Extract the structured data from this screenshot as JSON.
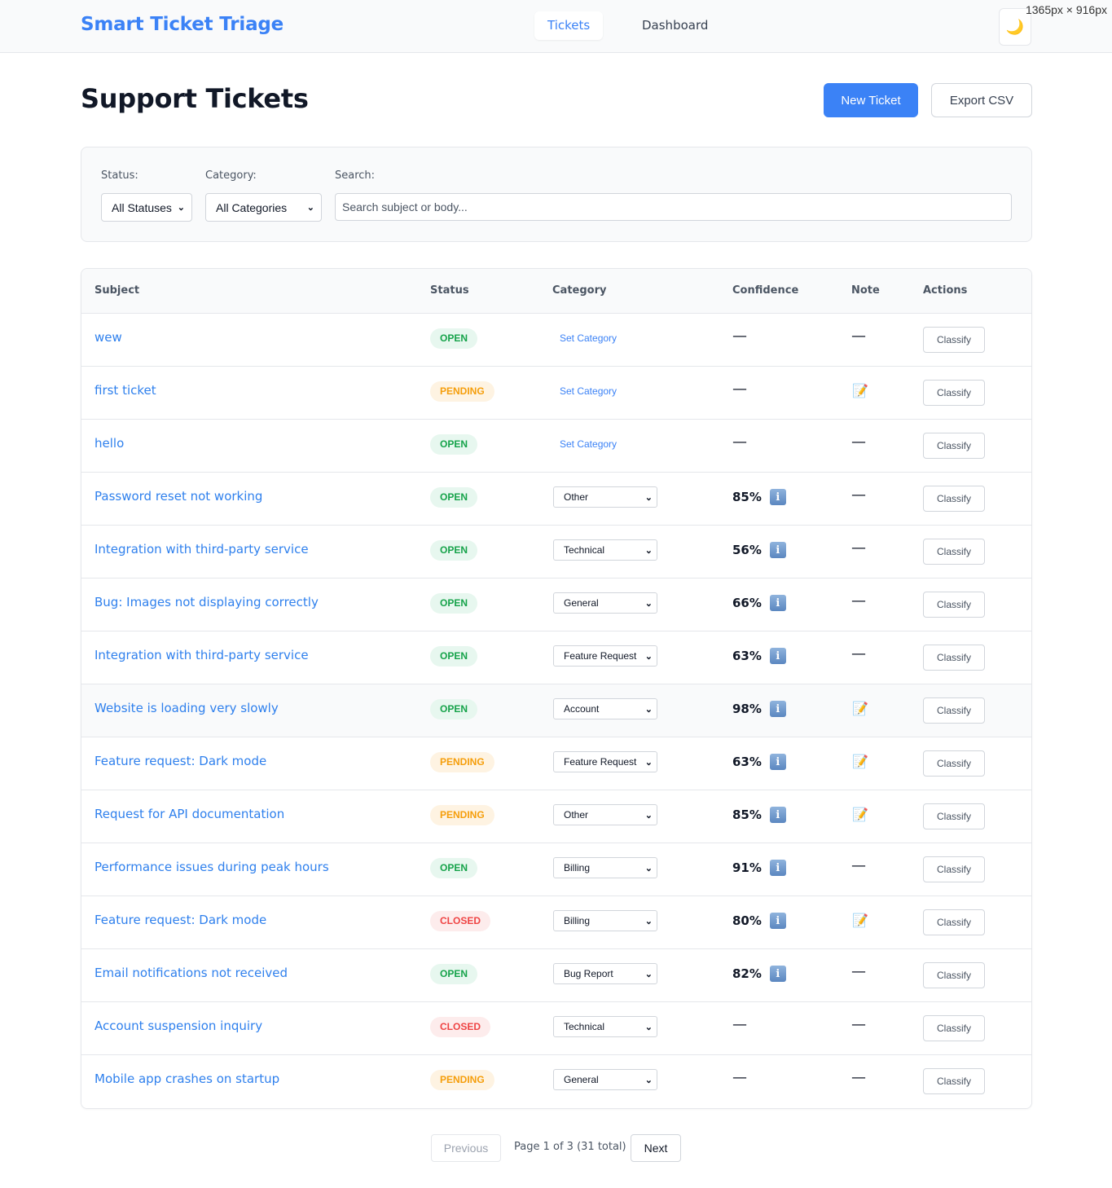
{
  "viewport_label": "1365px × 916px",
  "app": {
    "title": "Smart Ticket Triage"
  },
  "nav": {
    "tabs": [
      {
        "label": "Tickets",
        "active": true
      },
      {
        "label": "Dashboard",
        "active": false
      }
    ],
    "theme_icon": "🌙"
  },
  "page": {
    "title": "Support Tickets",
    "new_ticket": "New Ticket",
    "export_csv": "Export CSV"
  },
  "filters": {
    "status_label": "Status:",
    "status_value": "All Statuses",
    "category_label": "Category:",
    "category_value": "All Categories",
    "search_label": "Search:",
    "search_placeholder": "Search subject or body..."
  },
  "table": {
    "columns": [
      "Subject",
      "Status",
      "Category",
      "Confidence",
      "Note",
      "Actions"
    ],
    "dash": "—",
    "note_icon": "📝",
    "info_icon": "i",
    "set_category": "Set Category",
    "classify": "Classify",
    "rows": [
      {
        "subject": "wew",
        "status": "OPEN",
        "category": null,
        "confidence": null,
        "note": false
      },
      {
        "subject": "first ticket",
        "status": "PENDING",
        "category": null,
        "confidence": null,
        "note": true
      },
      {
        "subject": "hello",
        "status": "OPEN",
        "category": null,
        "confidence": null,
        "note": false
      },
      {
        "subject": "Password reset not working",
        "status": "OPEN",
        "category": "Other",
        "confidence": "85%",
        "note": false
      },
      {
        "subject": "Integration with third-party service",
        "status": "OPEN",
        "category": "Technical",
        "confidence": "56%",
        "note": false
      },
      {
        "subject": "Bug: Images not displaying correctly",
        "status": "OPEN",
        "category": "General",
        "confidence": "66%",
        "note": false
      },
      {
        "subject": "Integration with third-party service",
        "status": "OPEN",
        "category": "Feature Request",
        "confidence": "63%",
        "note": false
      },
      {
        "subject": "Website is loading very slowly",
        "status": "OPEN",
        "category": "Account",
        "confidence": "98%",
        "note": true
      },
      {
        "subject": "Feature request: Dark mode",
        "status": "PENDING",
        "category": "Feature Request",
        "confidence": "63%",
        "note": true
      },
      {
        "subject": "Request for API documentation",
        "status": "PENDING",
        "category": "Other",
        "confidence": "85%",
        "note": true
      },
      {
        "subject": "Performance issues during peak hours",
        "status": "OPEN",
        "category": "Billing",
        "confidence": "91%",
        "note": false
      },
      {
        "subject": "Feature request: Dark mode",
        "status": "CLOSED",
        "category": "Billing",
        "confidence": "80%",
        "note": true
      },
      {
        "subject": "Email notifications not received",
        "status": "OPEN",
        "category": "Bug Report",
        "confidence": "82%",
        "note": false
      },
      {
        "subject": "Account suspension inquiry",
        "status": "CLOSED",
        "category": "Technical",
        "confidence": null,
        "note": false
      },
      {
        "subject": "Mobile app crashes on startup",
        "status": "PENDING",
        "category": "General",
        "confidence": null,
        "note": false
      }
    ]
  },
  "pagination": {
    "previous": "Previous",
    "info": "Page 1 of 3 (31 total)",
    "next": "Next"
  },
  "colors": {
    "accent": "#3b82f6",
    "open": "#16a34a",
    "pending": "#f59e0b",
    "closed": "#ef4444"
  }
}
